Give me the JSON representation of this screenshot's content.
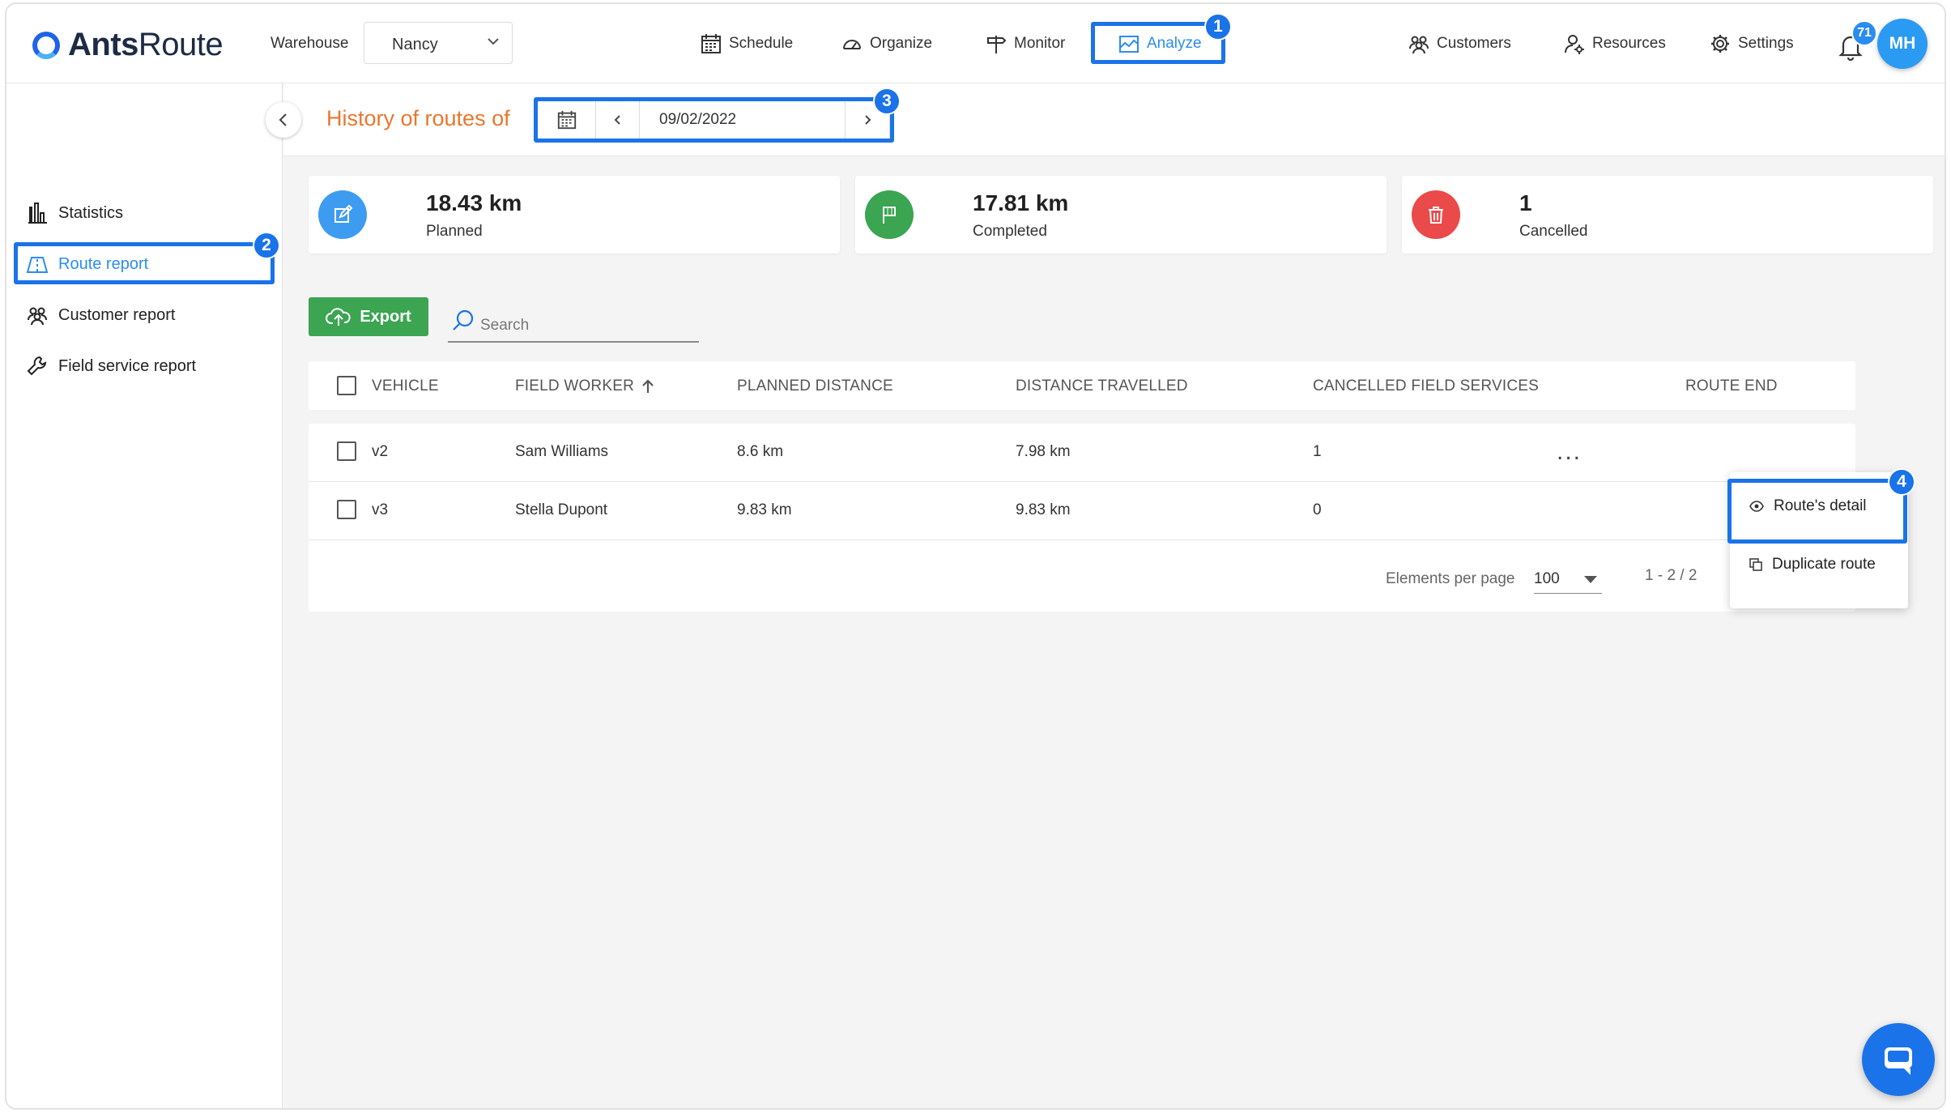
{
  "brand": {
    "name_bold": "Ants",
    "name_light": "Route"
  },
  "warehouse": {
    "label": "Warehouse",
    "value": "Nancy"
  },
  "nav": {
    "schedule": "Schedule",
    "organize": "Organize",
    "monitor": "Monitor",
    "analyze": "Analyze",
    "customers": "Customers",
    "resources": "Resources",
    "settings": "Settings"
  },
  "notifications": {
    "count": "71"
  },
  "user": {
    "initials": "MH"
  },
  "sidebar": {
    "items": [
      {
        "label": "Statistics"
      },
      {
        "label": "Route report"
      },
      {
        "label": "Customer report"
      },
      {
        "label": "Field service report"
      }
    ]
  },
  "header": {
    "title": "History of routes of",
    "date": "09/02/2022"
  },
  "summary": [
    {
      "value": "18.43 km",
      "label": "Planned",
      "color": "#3d9cf0"
    },
    {
      "value": "17.81 km",
      "label": "Completed",
      "color": "#3ba552"
    },
    {
      "value": "1",
      "label": "Cancelled",
      "color": "#ea4a4a"
    }
  ],
  "toolbar": {
    "export_label": "Export",
    "search_placeholder": "Search"
  },
  "table": {
    "columns": [
      "VEHICLE",
      "FIELD WORKER",
      "PLANNED DISTANCE",
      "DISTANCE TRAVELLED",
      "CANCELLED FIELD SERVICES",
      "ROUTE END"
    ],
    "rows": [
      {
        "vehicle": "v2",
        "worker": "Sam Williams",
        "planned": "8.6 km",
        "travelled": "7.98 km",
        "cancelled": "1"
      },
      {
        "vehicle": "v3",
        "worker": "Stella Dupont",
        "planned": "9.83 km",
        "travelled": "9.83 km",
        "cancelled": "0"
      }
    ]
  },
  "pagination": {
    "per_page_label": "Elements per page",
    "per_page_value": "100",
    "range": "1 - 2 / 2"
  },
  "context_menu": {
    "items": [
      {
        "label": "Route's detail"
      },
      {
        "label": "Duplicate route"
      }
    ]
  },
  "step_badges": [
    "1",
    "2",
    "3",
    "4"
  ],
  "accent_color": "#1a73e8"
}
